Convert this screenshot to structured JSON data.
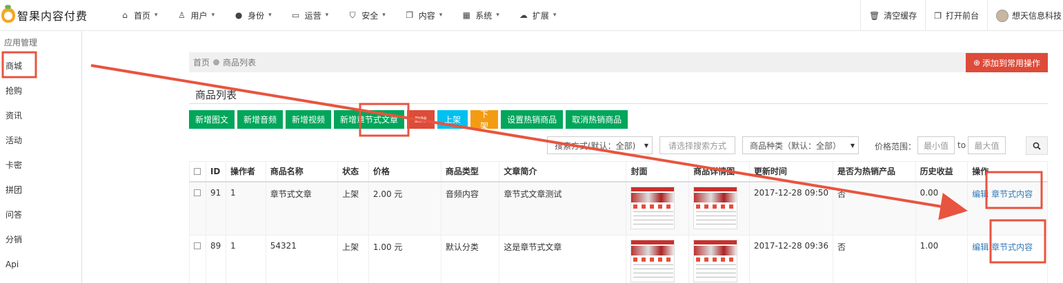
{
  "brand": {
    "name": "智果内容付费"
  },
  "nav": [
    {
      "label": "首页",
      "icon": "home-icon"
    },
    {
      "label": "用户",
      "icon": "user-icon"
    },
    {
      "label": "身份",
      "icon": "users-icon"
    },
    {
      "label": "运营",
      "icon": "monitor-icon"
    },
    {
      "label": "安全",
      "icon": "shield-icon"
    },
    {
      "label": "内容",
      "icon": "copy-icon"
    },
    {
      "label": "系统",
      "icon": "windows-icon"
    },
    {
      "label": "扩展",
      "icon": "cloud-icon"
    }
  ],
  "top_right": {
    "clear_cache": "清空缓存",
    "open_front": "打开前台",
    "user_name": "想天信息科技"
  },
  "sidebar": {
    "title": "应用管理",
    "items": [
      "商城",
      "抢购",
      "资讯",
      "活动",
      "卡密",
      "拼团",
      "问答",
      "分销",
      "Api"
    ]
  },
  "breadcrumb": {
    "home": "首页",
    "current": "商品列表"
  },
  "add_common": "添加到常用操作",
  "page_title": "商品列表",
  "actions": {
    "new_article": "新增图文",
    "new_audio": "新增音频",
    "new_video": "新增视频",
    "new_chapter": "新增章节式文章",
    "delete": "删除",
    "on_shelf": "上架",
    "off_shelf": "下架",
    "set_hot": "设置热销商品",
    "cancel_hot": "取消热销商品"
  },
  "filters": {
    "search_mode": "搜索方式(默认：全部)",
    "search_input_placeholder": "请选择搜索方式",
    "category": "商品种类（默认：全部）",
    "price_label": "价格范围：",
    "min_placeholder": "最小值",
    "to": "to",
    "max_placeholder": "最大值"
  },
  "table": {
    "headers": [
      "ID",
      "操作者",
      "商品名称",
      "状态",
      "价格",
      "商品类型",
      "文章简介",
      "封面",
      "商品详情图",
      "更新时间",
      "是否为热销产品",
      "历史收益",
      "操作"
    ],
    "rows": [
      {
        "id": "91",
        "operator": "1",
        "name": "章节式文章",
        "status": "上架",
        "price": "2.00 元",
        "type": "音频内容",
        "intro": "章节式文章测试",
        "updated": "2017-12-28 09:50",
        "hot": "否",
        "revenue": "0.00",
        "edit": "编辑",
        "chapter": "章节式内容"
      },
      {
        "id": "89",
        "operator": "1",
        "name": "54321",
        "status": "上架",
        "price": "1.00 元",
        "type": "默认分类",
        "intro": "这是章节式文章",
        "updated": "2017-12-28 09:36",
        "hot": "否",
        "revenue": "1.00",
        "edit": "编辑",
        "chapter": "章节式内容"
      }
    ]
  },
  "colors": {
    "green": "#00a65a",
    "red": "#dd4b39",
    "blue": "#00c0ef",
    "orange": "#f39c12",
    "annotation": "#e8543f",
    "link": "#337ab7"
  }
}
